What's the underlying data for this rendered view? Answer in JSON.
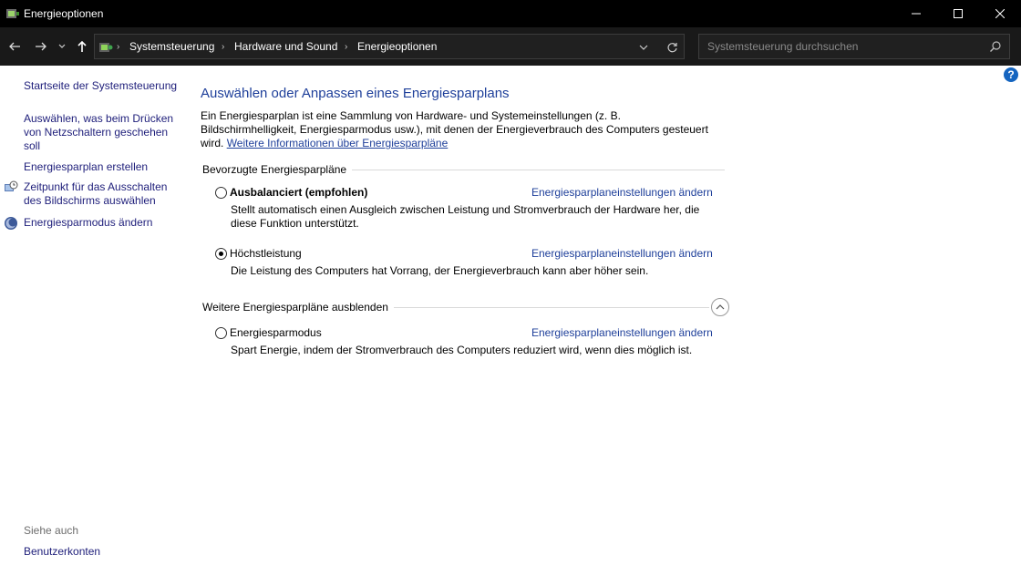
{
  "window": {
    "title": "Energieoptionen"
  },
  "address": {
    "breadcrumbs": [
      "Systemsteuerung",
      "Hardware und Sound",
      "Energieoptionen"
    ]
  },
  "search": {
    "placeholder": "Systemsteuerung durchsuchen"
  },
  "sidebar": {
    "items": [
      {
        "label": "Startseite der Systemsteuerung"
      },
      {
        "label": "Auswählen, was beim Drücken von Netzschaltern geschehen soll"
      },
      {
        "label": "Energiesparplan erstellen"
      },
      {
        "label": "Zeitpunkt für das Ausschalten des Bildschirms auswählen",
        "icon": "clock-monitor-icon"
      },
      {
        "label": "Energiesparmodus ändern",
        "icon": "moon-globe-icon"
      }
    ],
    "see_also": {
      "heading": "Siehe auch",
      "items": [
        {
          "label": "Benutzerkonten"
        }
      ]
    }
  },
  "main": {
    "title": "Auswählen oder Anpassen eines Energiesparplans",
    "intro_text": "Ein Energiesparplan ist eine Sammlung von Hardware- und Systemeinstellungen (z. B. Bildschirmhelligkeit, Energiesparmodus usw.), mit denen der Energieverbrauch des Computers gesteuert wird.",
    "intro_link": "Weitere Informationen über Energiesparpläne",
    "preferred_heading": "Bevorzugte Energiesparpläne",
    "more_heading": "Weitere Energiesparpläne ausblenden",
    "change_label": "Energiesparplaneinstellungen ändern",
    "plans": [
      {
        "name": "Ausbalanciert (empfohlen)",
        "description": "Stellt automatisch einen Ausgleich zwischen Leistung und Stromverbrauch der Hardware her, die diese Funktion unterstützt.",
        "selected": false
      },
      {
        "name": "Höchstleistung",
        "description": "Die Leistung des Computers hat Vorrang, der Energieverbrauch kann aber höher sein.",
        "selected": true
      },
      {
        "name": "Energiesparmodus",
        "description": "Spart Energie, indem der Stromverbrauch des Computers reduziert wird, wenn dies möglich ist.",
        "selected": false
      }
    ]
  },
  "help": {
    "label": "?"
  },
  "colors": {
    "titlebar_bg": "#000000",
    "navbar_bg": "#191919",
    "link": "#1e3f9a",
    "sidebar_link": "#1e1e7a"
  }
}
